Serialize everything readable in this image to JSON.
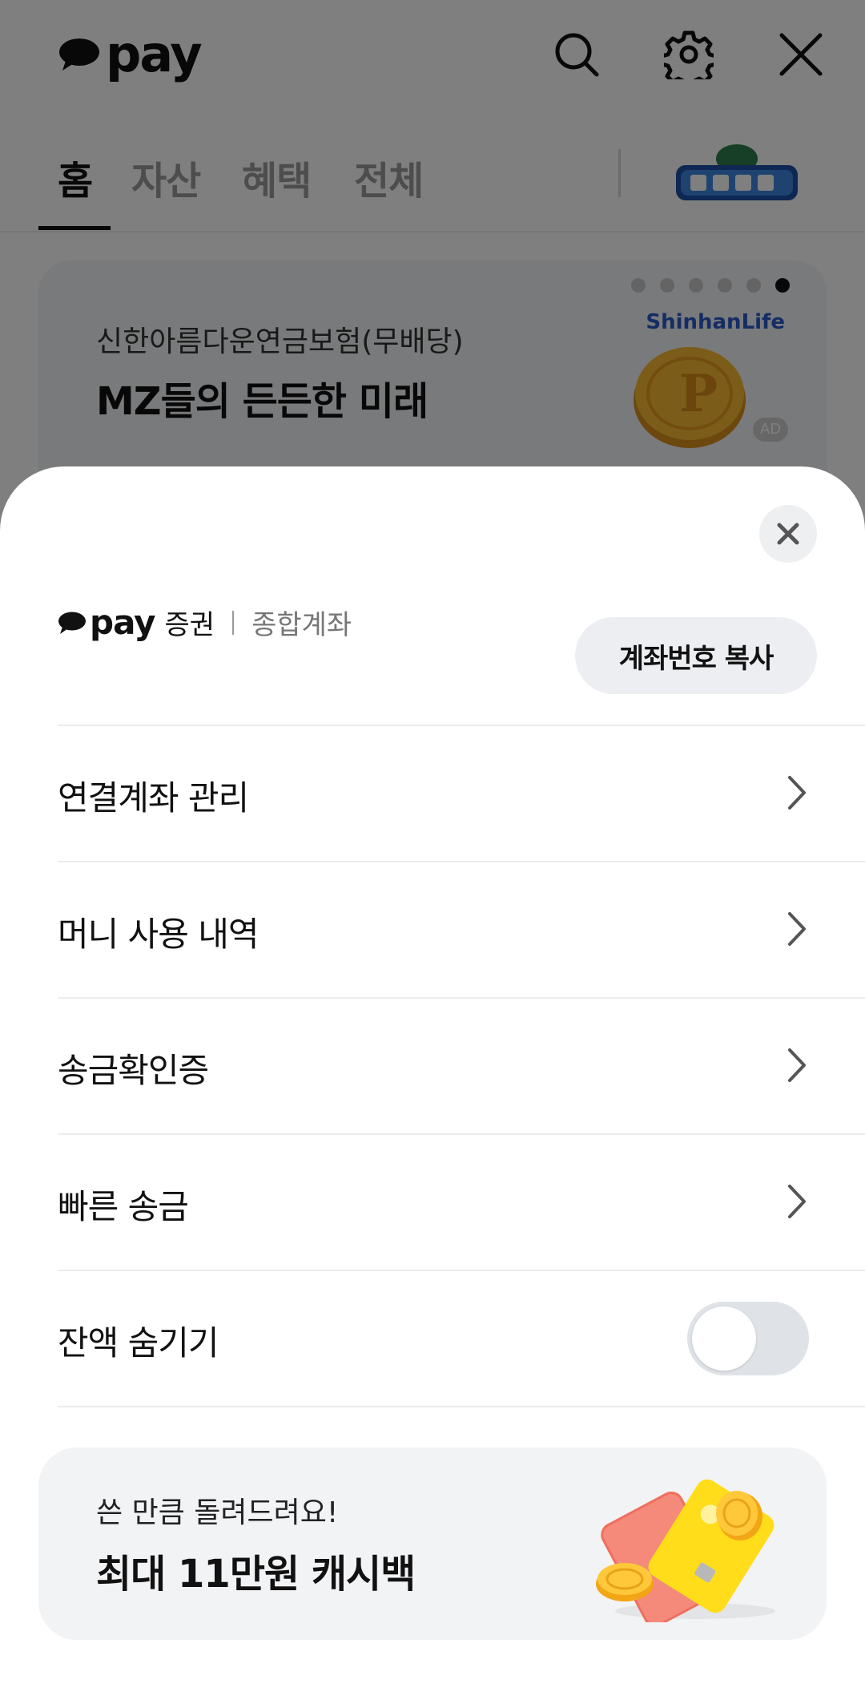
{
  "header": {
    "logo_text": "pay",
    "icons": [
      "search-icon",
      "gear-icon",
      "close-icon"
    ]
  },
  "tabs": [
    {
      "label": "홈",
      "active": true
    },
    {
      "label": "자산",
      "active": false
    },
    {
      "label": "혜택",
      "active": false
    },
    {
      "label": "전체",
      "active": false
    }
  ],
  "ad_banner": {
    "subtitle": "신한아름다운연금보험(무배당)",
    "title": "MZ들의 든든한 미래",
    "brand": "ShinhanLife",
    "badge": "AD",
    "page_count": 6,
    "current_page": 6
  },
  "sheet": {
    "account": {
      "brand": "pay",
      "service": "증권",
      "type": "종합계좌"
    },
    "copy_button_label": "계좌번호 복사",
    "menu": [
      {
        "label": "연결계좌 관리",
        "kind": "link"
      },
      {
        "label": "머니 사용 내역",
        "kind": "link"
      },
      {
        "label": "송금확인증",
        "kind": "link"
      },
      {
        "label": "빠른 송금",
        "kind": "link"
      },
      {
        "label": "잔액 숨기기",
        "kind": "toggle",
        "on": false
      }
    ],
    "promo": {
      "subtitle": "쓴 만큼 돌려드려요!",
      "title": "최대 11만원 캐시백"
    }
  },
  "colors": {
    "brand_yellow": "#FEE500",
    "dim_overlay": "rgba(0,0,0,0.5)",
    "toggle_off": "#dfe2e6"
  }
}
